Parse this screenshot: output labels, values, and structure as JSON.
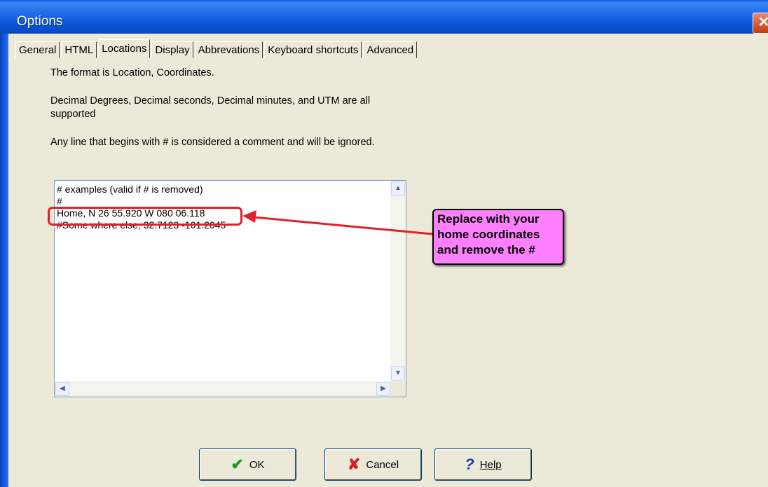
{
  "window": {
    "title": "Options",
    "close_glyph": "✕"
  },
  "tabs": [
    {
      "label": "General"
    },
    {
      "label": "HTML"
    },
    {
      "label": "Locations",
      "active": true
    },
    {
      "label": "Display"
    },
    {
      "label": "Abbrevations"
    },
    {
      "label": "Keyboard shortcuts"
    },
    {
      "label": "Advanced"
    }
  ],
  "info": {
    "line1": "The format is Location, Coordinates.",
    "line2": "Decimal Degrees, Decimal seconds, Decimal minutes, and UTM are all",
    "line3": "supported",
    "line4": "Any line that begins with # is considered a comment and will be ignored."
  },
  "locations_text": {
    "lines": [
      "# examples (valid if # is removed)",
      "#",
      "Home, N 26 55.920  W 080 06.118",
      "#Some where else,  32.7123  -101.2045"
    ]
  },
  "callout": {
    "line1": "Replace with your",
    "line2": "home coordinates",
    "line3": "and remove the #"
  },
  "buttons": {
    "ok_label": "OK",
    "cancel_label": "Cancel",
    "help_label": "Help",
    "ok_icon": "✔",
    "cancel_icon": "✘",
    "help_icon": "?"
  },
  "colors": {
    "title_bar": "#0a52d4",
    "callout_bg": "#ff80ff",
    "annotation_red": "#e0202a"
  }
}
